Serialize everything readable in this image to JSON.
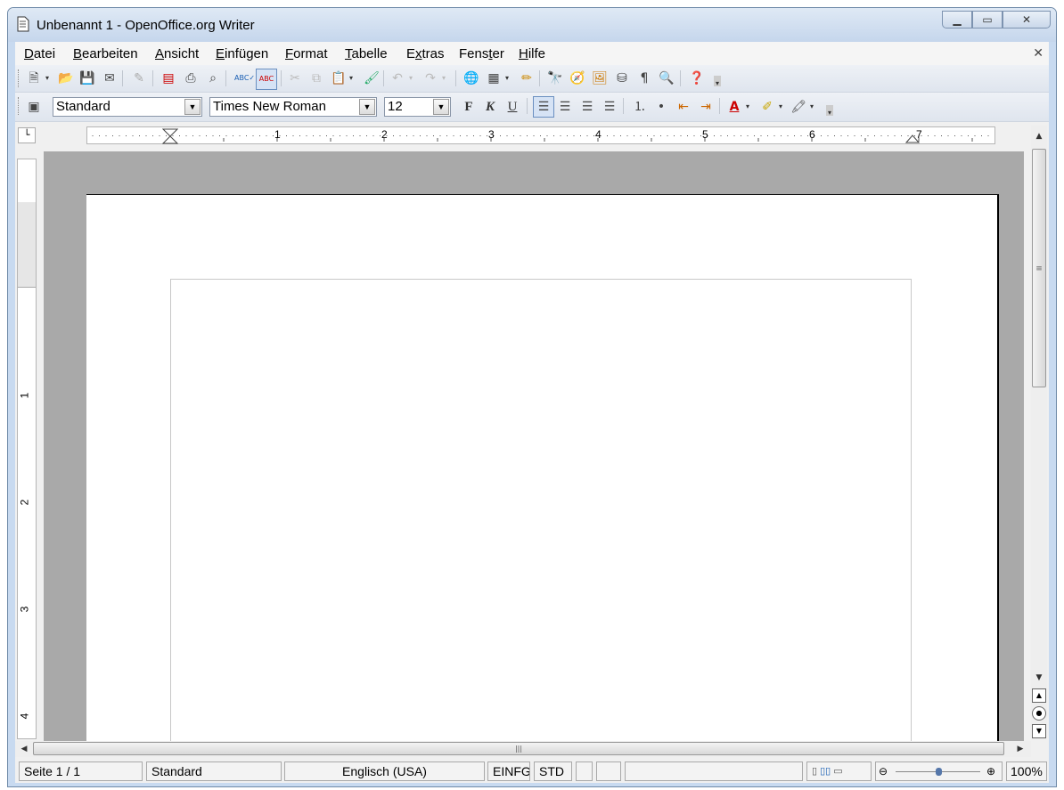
{
  "window": {
    "title": "Unbenannt 1 - OpenOffice.org Writer"
  },
  "menu": {
    "items": [
      {
        "label": "Datei",
        "key": "D",
        "rest": "atei"
      },
      {
        "label": "Bearbeiten",
        "key": "B",
        "rest": "earbeiten"
      },
      {
        "label": "Ansicht",
        "key": "A",
        "rest": "nsicht"
      },
      {
        "label": "Einfügen",
        "key": "E",
        "rest": "infügen"
      },
      {
        "label": "Format",
        "key": "F",
        "rest": "ormat"
      },
      {
        "label": "Tabelle",
        "key": "T",
        "rest": "abelle"
      },
      {
        "label": "Extras",
        "pre": "E",
        "key": "x",
        "rest": "tras"
      },
      {
        "label": "Fenster",
        "pre": "Fens",
        "key": "t",
        "rest": "er"
      },
      {
        "label": "Hilfe",
        "key": "H",
        "rest": "ilfe"
      }
    ]
  },
  "formatting": {
    "style": "Standard",
    "font": "Times New Roman",
    "size": "12",
    "bold_label": "F",
    "italic_label": "K",
    "underline_label": "U"
  },
  "ruler": {
    "h_numbers": [
      "1",
      "2",
      "3",
      "4",
      "5",
      "6",
      "7"
    ],
    "v_numbers": [
      "1",
      "2",
      "3",
      "4"
    ]
  },
  "status": {
    "page": "Seite 1 / 1",
    "style": "Standard",
    "language": "Englisch (USA)",
    "insert_mode": "EINFG",
    "selection_mode": "STD",
    "zoom": "100%"
  },
  "zoom_level": 100
}
